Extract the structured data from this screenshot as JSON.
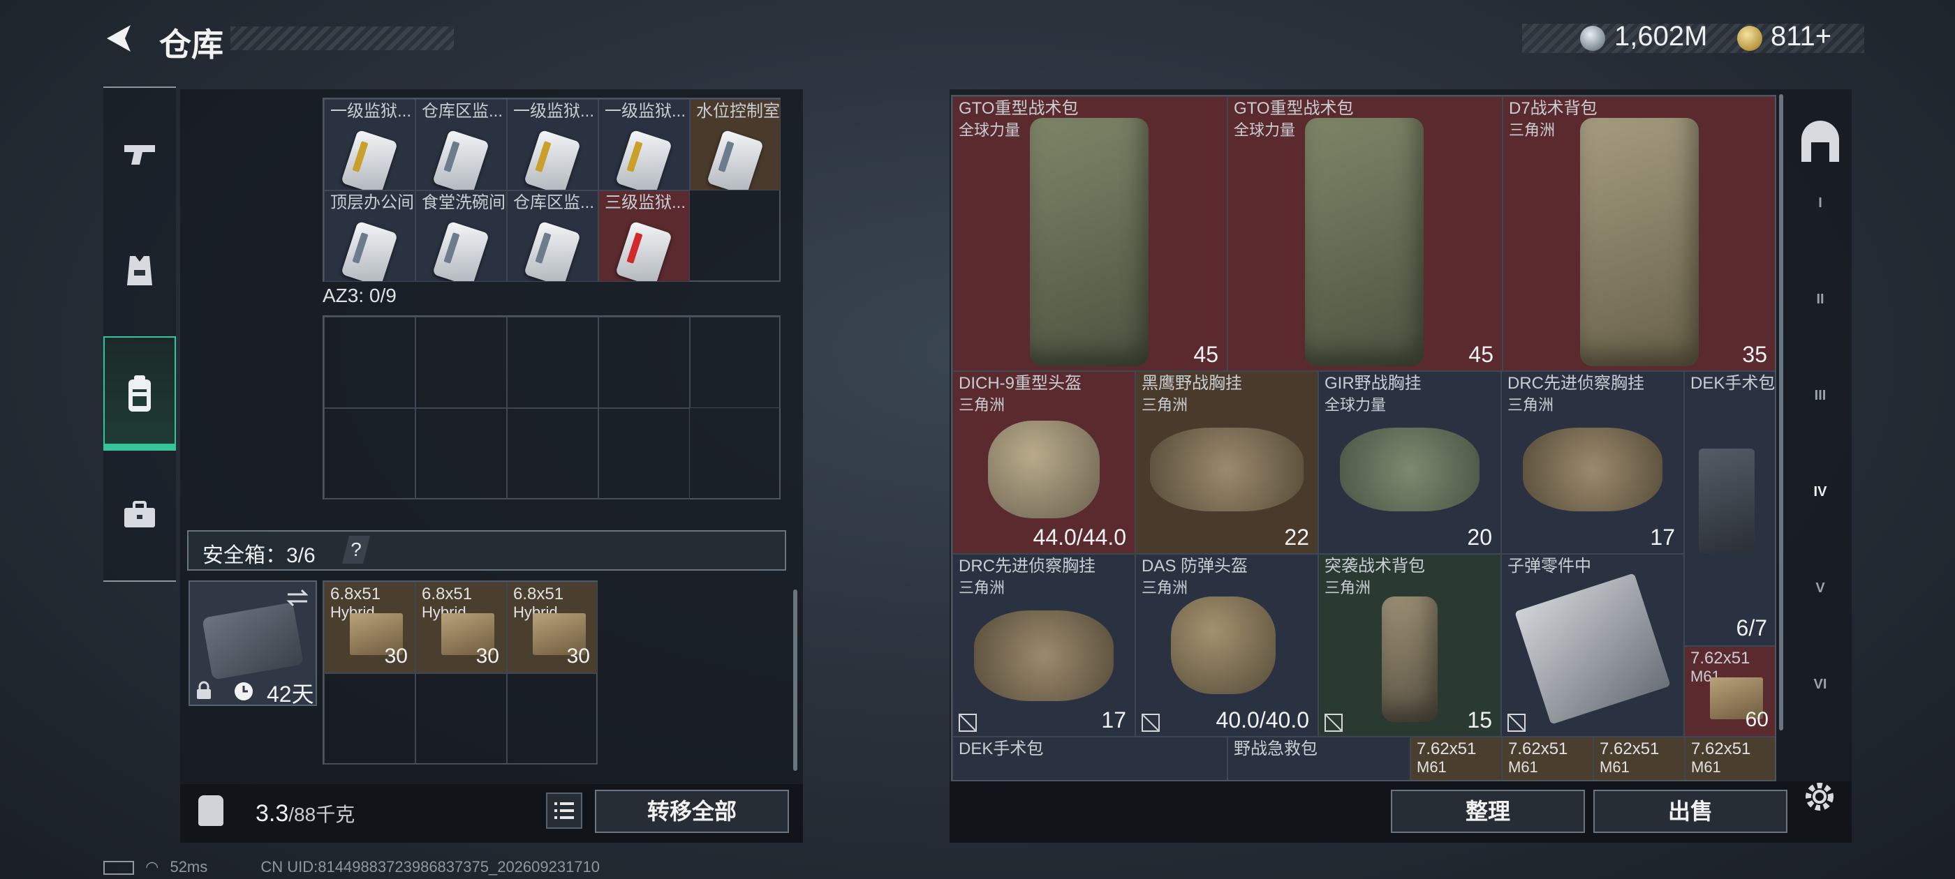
{
  "header": {
    "title": "仓库"
  },
  "currency": {
    "silver": "1,602M",
    "gold": "811+"
  },
  "left_nav": [
    {
      "name": "weapon"
    },
    {
      "name": "armor"
    },
    {
      "name": "backpack",
      "active": true
    },
    {
      "name": "case"
    }
  ],
  "keycards_row1": [
    "一级监狱...",
    "仓库区监...",
    "一级监狱...",
    "一级监狱...",
    "水位控制室"
  ],
  "keycards_row2": [
    "顶层办公间",
    "食堂洗碗间",
    "仓库区监...",
    "三级监狱..."
  ],
  "az3_label": "AZ3: 0/9",
  "safe_box": {
    "label": "安全箱：3/6",
    "help": "?",
    "timer": "42天"
  },
  "ammo": [
    {
      "name": "6.8x51",
      "sub": "Hybrid",
      "count": "30"
    },
    {
      "name": "6.8x51",
      "sub": "Hybrid",
      "count": "30"
    },
    {
      "name": "6.8x51",
      "sub": "Hybrid",
      "count": "30"
    }
  ],
  "weight": {
    "value": "3.3",
    "max": "/88千克"
  },
  "buttons": {
    "transfer_all": "转移全部",
    "sort": "整理",
    "sell": "出售"
  },
  "items": {
    "gto1": {
      "name": "GTO重型战术包",
      "sub": "全球力量",
      "stat": "45"
    },
    "gto2": {
      "name": "GTO重型战术包",
      "sub": "全球力量",
      "stat": "45"
    },
    "d7": {
      "name": "D7战术背包",
      "sub": "三角洲",
      "stat": "35"
    },
    "dich": {
      "name": "DICH-9重型头盔",
      "sub": "三角洲",
      "stat": "44.0/44.0"
    },
    "heiying": {
      "name": "黑鹰野战胸挂",
      "sub": "三角洲",
      "stat": "22"
    },
    "gir": {
      "name": "GIR野战胸挂",
      "sub": "全球力量",
      "stat": "20"
    },
    "drc1": {
      "name": "DRC先进侦察胸挂",
      "sub": "三角洲",
      "stat": "17"
    },
    "dek1": {
      "name": "DEK手术包",
      "stat": "6/7"
    },
    "drc2": {
      "name": "DRC先进侦察胸挂",
      "sub": "三角洲",
      "stat": "17"
    },
    "das": {
      "name": "DAS 防弹头盔",
      "sub": "三角洲",
      "stat": "40.0/40.0"
    },
    "tuxi": {
      "name": "突袭战术背包",
      "sub": "三角洲",
      "stat": "15"
    },
    "zidan": {
      "name": "子弹零件中"
    },
    "ammo762": {
      "name": "7.62x51",
      "sub": "M61",
      "stat": "60"
    },
    "dek2": {
      "name": "DEK手术包"
    },
    "yezhan": {
      "name": "野战急救包"
    },
    "ammo_row": [
      "7.62x51",
      "7.62x51",
      "7.62x51",
      "7.62x51"
    ],
    "ammo_row_sub": "M61"
  },
  "right_nav": [
    "I",
    "II",
    "III",
    "IV",
    "V",
    "VI"
  ],
  "status": {
    "ping": "52ms",
    "uid": "CN UID:81449883723986837375_202609231710"
  },
  "colors": {
    "accent": "#36c49a",
    "red_cell": "#5a2a2f",
    "slate_cell": "#2a3140"
  }
}
